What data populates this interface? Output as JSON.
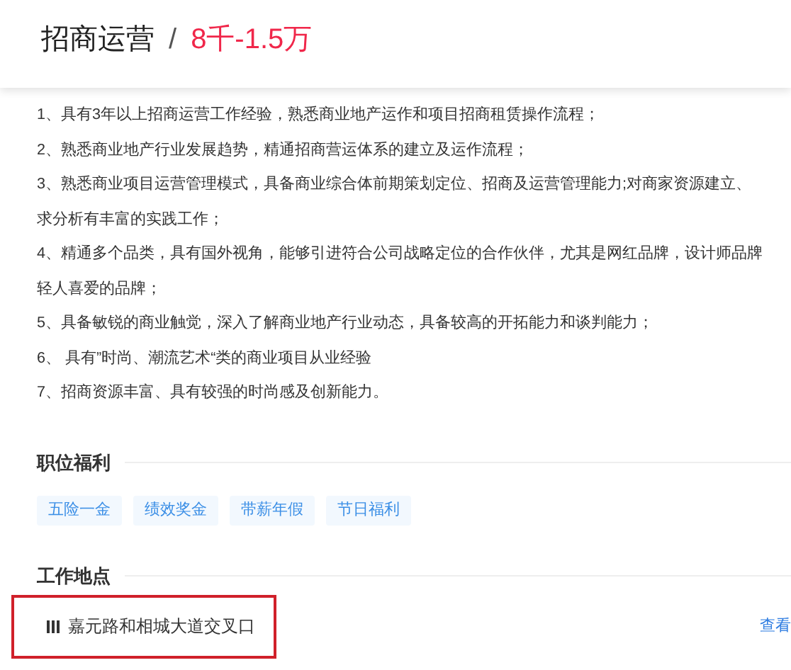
{
  "header": {
    "title": "招商运营",
    "separator": "/",
    "salary": "8千-1.5万"
  },
  "requirements": [
    {
      "lines": [
        "1、具有3年以上招商运营工作经验，熟悉商业地产运作和项目招商租赁操作流程；"
      ]
    },
    {
      "lines": [
        "2、熟悉商业地产行业发展趋势，精通招商营运体系的建立及运作流程；"
      ]
    },
    {
      "lines": [
        "3、熟悉商业项目运营管理模式，具备商业综合体前期策划定位、招商及运营管理能力;对商家资源建立、",
        "求分析有丰富的实践工作；"
      ]
    },
    {
      "lines": [
        "4、精通多个品类，具有国外视角，能够引进符合公司战略定位的合作伙伴，尤其是网红品牌，设计师品牌",
        "轻人喜爱的品牌；"
      ]
    },
    {
      "lines": [
        "5、具备敏锐的商业触觉，深入了解商业地产行业动态，具备较高的开拓能力和谈判能力；"
      ]
    },
    {
      "lines": [
        "6、 具有”时尚、潮流艺术“类的商业项目从业经验"
      ]
    },
    {
      "lines": [
        "7、招商资源丰富、具有较强的时尚感及创新能力。"
      ]
    }
  ],
  "benefits": {
    "heading": "职位福利",
    "tags": [
      "五险一金",
      "绩效奖金",
      "带薪年假",
      "节日福利"
    ]
  },
  "location": {
    "heading": "工作地点",
    "address": "嘉元路和相城大道交叉口",
    "highlighted": true,
    "map_link": "查看"
  }
}
